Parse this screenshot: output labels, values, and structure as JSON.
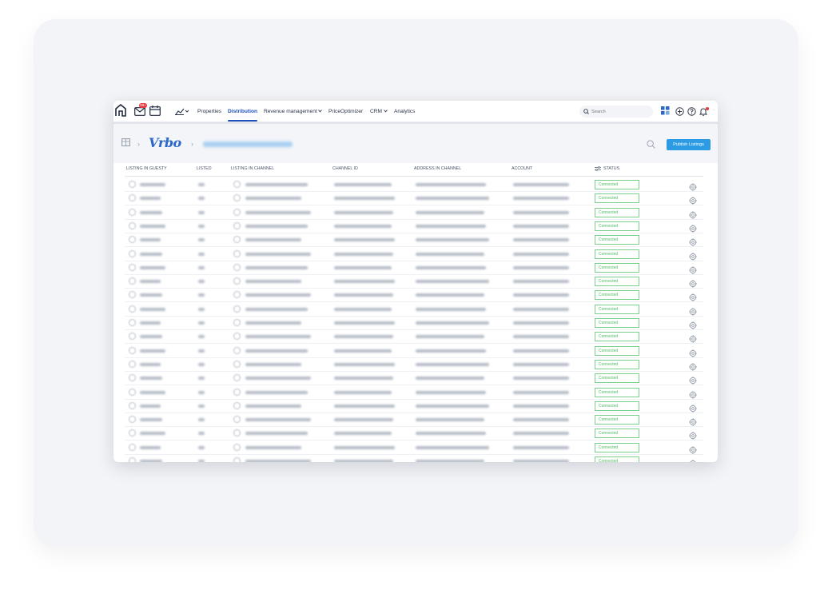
{
  "nav": {
    "mail_badge": "99+",
    "links": [
      "Properties",
      "Distribution",
      "Revenue management",
      "PriceOptimizer",
      "CRM",
      "Analytics"
    ],
    "active": "Distribution",
    "search_placeholder": "Search"
  },
  "header": {
    "channel": "Vrbo",
    "publish_label": "Publish Listings"
  },
  "table": {
    "columns": [
      "LISTING IN GUESTY",
      "LISTED",
      "LISTING IN CHANNEL",
      "CHANNEL ID",
      "ADDRESS IN CHANNEL",
      "ACCOUNT",
      "STATUS"
    ],
    "rows": [
      {
        "status": "Connected"
      },
      {
        "status": "Connected"
      },
      {
        "status": "Connected"
      },
      {
        "status": "Connected"
      },
      {
        "status": "Connected"
      },
      {
        "status": "Connected"
      },
      {
        "status": "Connected"
      },
      {
        "status": "Connected"
      },
      {
        "status": "Connected"
      },
      {
        "status": "Connected"
      },
      {
        "status": "Connected"
      },
      {
        "status": "Connected"
      },
      {
        "status": "Connected"
      },
      {
        "status": "Connected"
      },
      {
        "status": "Connected"
      },
      {
        "status": "Connected"
      },
      {
        "status": "Connected"
      },
      {
        "status": "Connected"
      },
      {
        "status": "Connected"
      },
      {
        "status": "Connected"
      },
      {
        "status": "Connected"
      }
    ]
  },
  "colors": {
    "accent": "#1d4fb8",
    "publish": "#2c9be3",
    "status_green": "#4dbb62"
  }
}
